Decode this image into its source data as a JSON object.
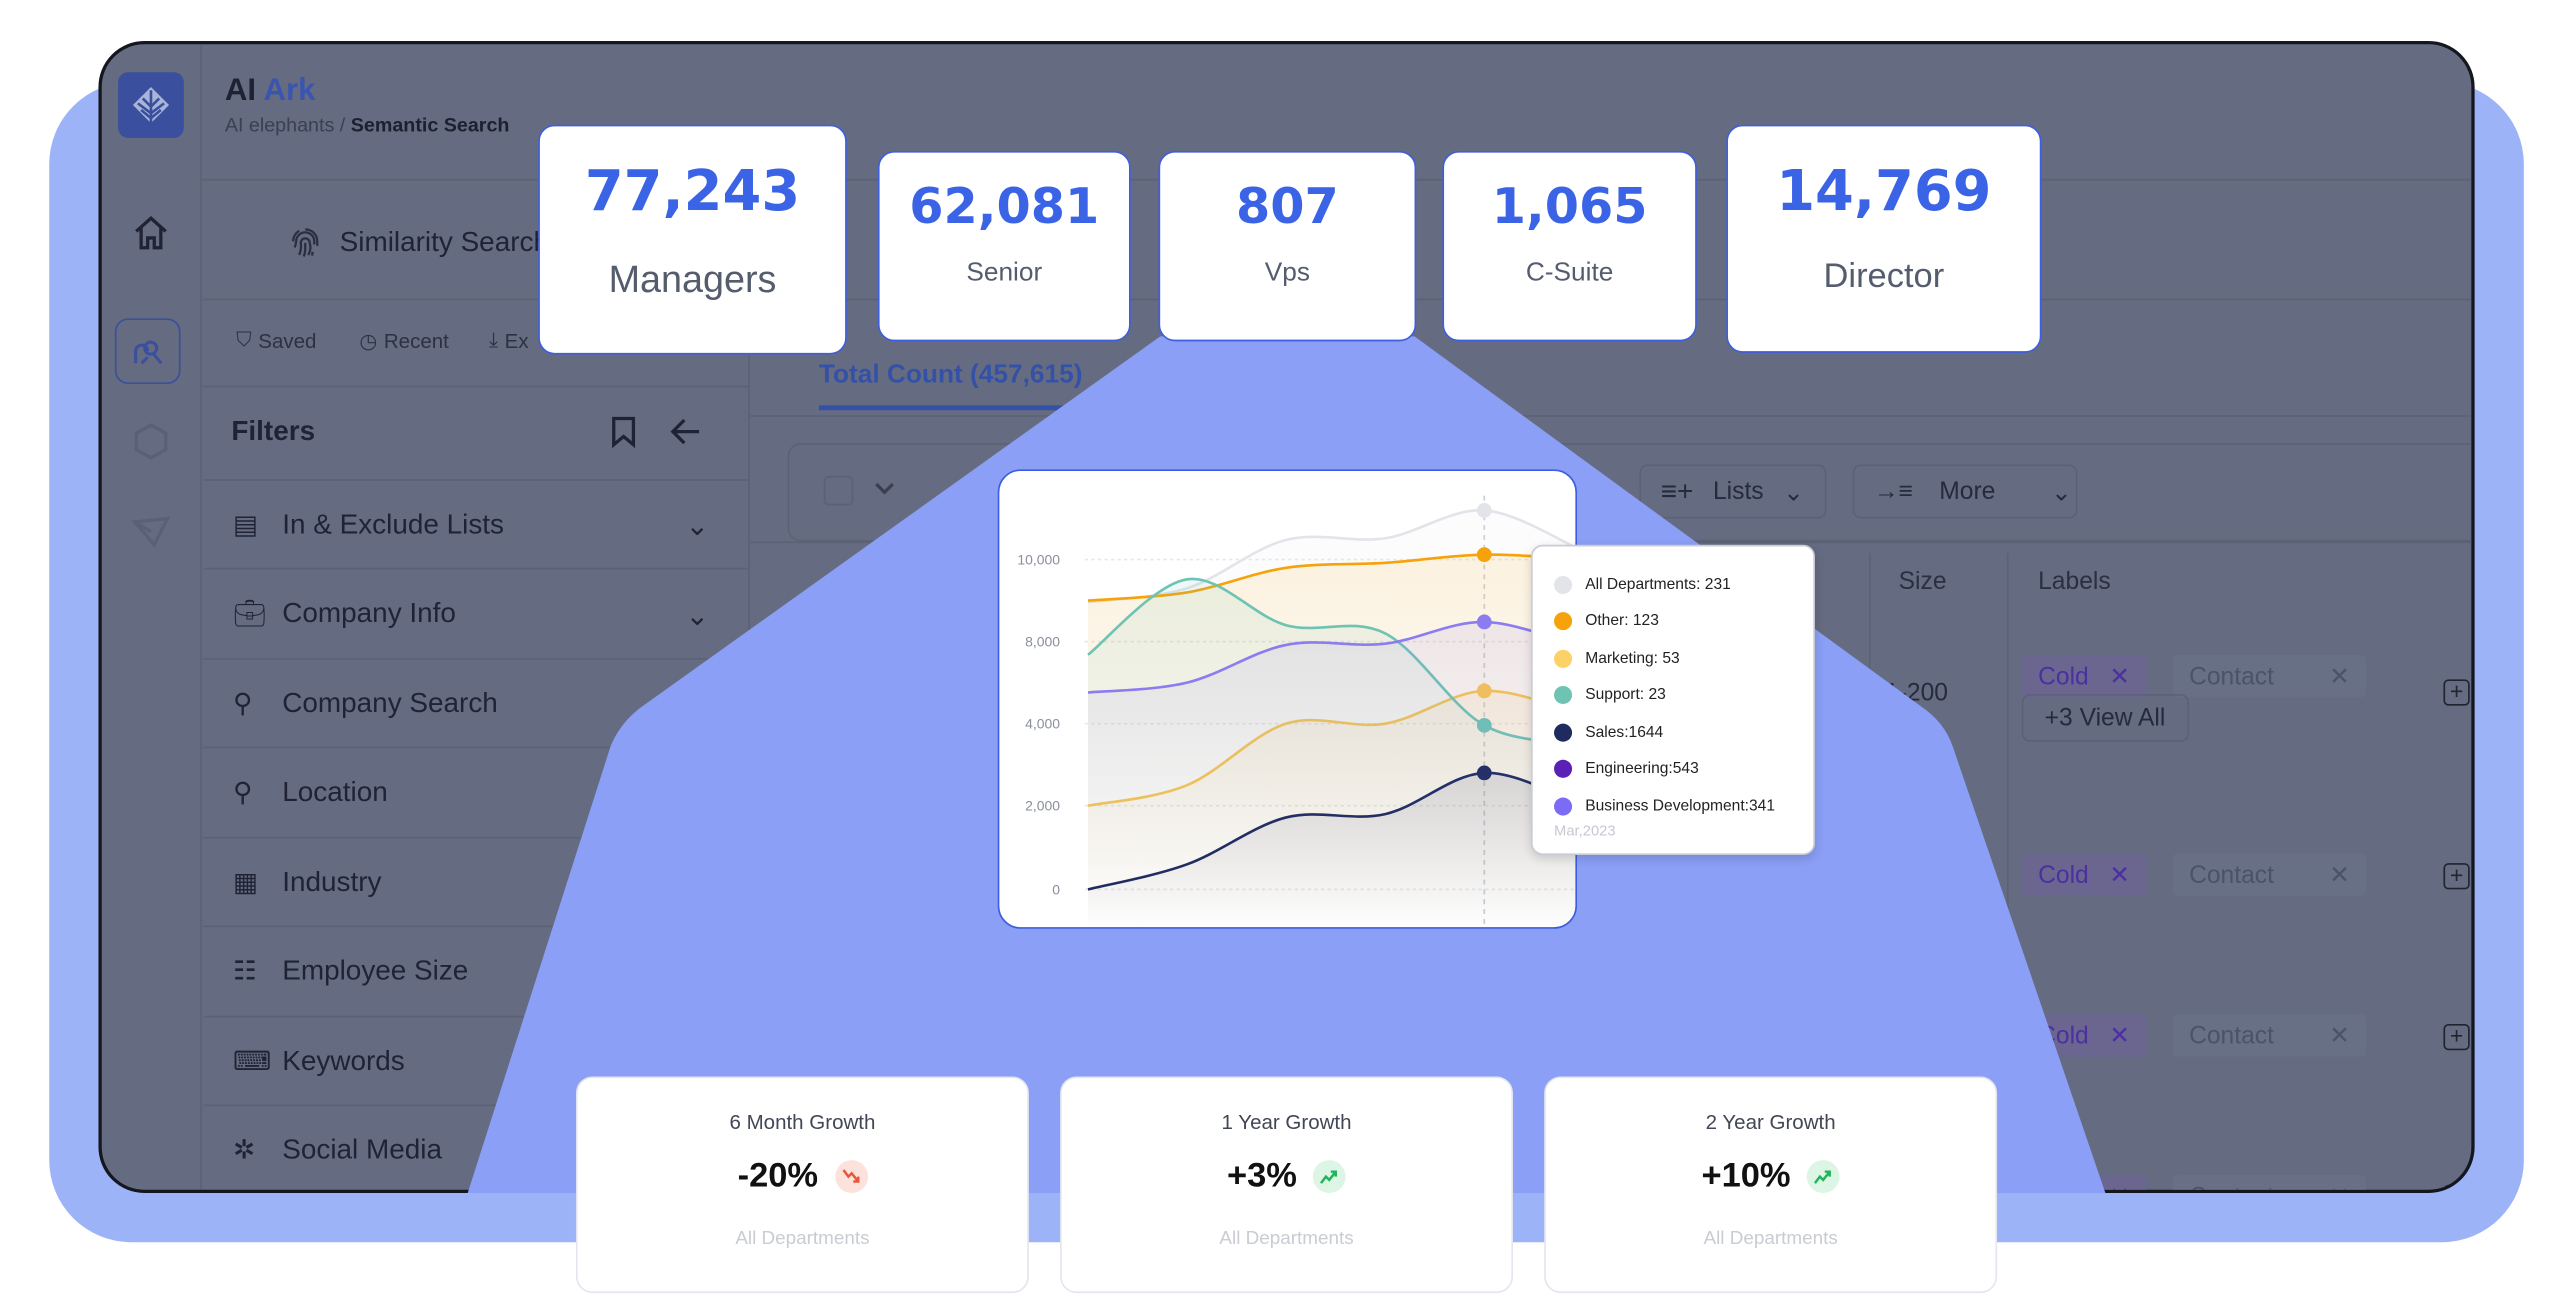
{
  "app": {
    "title_part1": "AI",
    "title_part2": "Ark",
    "breadcrumb_parent": "AI elephants /",
    "breadcrumb_current": "Semantic Search"
  },
  "panel": {
    "tab_label": "Similarity Search",
    "toolbar": {
      "saved": "Saved",
      "recent": "Recent",
      "export": "Ex"
    },
    "filters_title": "Filters",
    "filters": [
      {
        "label": "In & Exclude Lists",
        "icon": "list-icon",
        "expandable": true
      },
      {
        "label": "Company Info",
        "icon": "briefcase-icon",
        "expandable": true
      },
      {
        "label": "Company Search",
        "icon": "search-icon",
        "expandable": false
      },
      {
        "label": "Location",
        "icon": "location-pin-icon",
        "expandable": false
      },
      {
        "label": "Industry",
        "icon": "building-icon",
        "expandable": false
      },
      {
        "label": "Employee Size",
        "icon": "users-icon",
        "expandable": false
      },
      {
        "label": "Keywords",
        "icon": "keyboard-icon",
        "expandable": false
      },
      {
        "label": "Social Media",
        "icon": "network-icon",
        "expandable": false
      }
    ]
  },
  "main": {
    "tab_fragments": [
      "ch",
      "ch"
    ],
    "total_count": "Total Count (457,615)",
    "lists_button": "Lists",
    "more_button": "More",
    "columns": {
      "size": "Size",
      "labels": "Labels"
    },
    "rows": [
      {
        "size": "101-200",
        "labels": [
          "Cold",
          "Contact"
        ],
        "view_all": "+3 View All"
      },
      {
        "size": "",
        "labels": [
          "Cold",
          "Contact"
        ]
      },
      {
        "size": "",
        "labels": [
          "Cold",
          "Contact"
        ]
      },
      {
        "size": "",
        "labels": [
          "Cold",
          "Contact"
        ]
      }
    ]
  },
  "stats": [
    {
      "value": "77,243",
      "label": "Managers"
    },
    {
      "value": "62,081",
      "label": "Senior"
    },
    {
      "value": "807",
      "label": "Vps"
    },
    {
      "value": "1,065",
      "label": "C-Suite"
    },
    {
      "value": "14,769",
      "label": "Director"
    }
  ],
  "growth": [
    {
      "title": "6 Month Growth",
      "value": "-20%",
      "trend": "down",
      "subtitle": "All Departments"
    },
    {
      "title": "1 Year Growth",
      "value": "+3%",
      "trend": "up",
      "subtitle": "All Departments"
    },
    {
      "title": "2 Year Growth",
      "value": "+10%",
      "trend": "up",
      "subtitle": "All Departments"
    }
  ],
  "colors": {
    "accent": "#3a63e6",
    "highlight_bg": "#8a9ff5",
    "outer_bg": "#9db3f8",
    "down": "#e8553b",
    "up": "#22b45a"
  },
  "chart_data": {
    "type": "line",
    "title": "",
    "xlabel": "",
    "ylabel": "",
    "y_ticks": [
      "10,000",
      "8,000",
      "4,000",
      "2,000",
      "0"
    ],
    "grid": true,
    "series": [
      {
        "name": "All Departments",
        "color": "#e2e4e9",
        "values": [
          8960,
          9300,
          10480,
          10520,
          11200,
          10200
        ]
      },
      {
        "name": "Other",
        "color": "#f5a20b",
        "values": [
          9000,
          9200,
          9800,
          9920,
          10120,
          10000
        ]
      },
      {
        "name": "Marketing",
        "color": "#f8c550",
        "values": [
          2000,
          2500,
          4000,
          4000,
          5600,
          4400
        ]
      },
      {
        "name": "Support",
        "color": "#6ec3b3",
        "values": [
          7360,
          9520,
          8400,
          8200,
          3960,
          3500
        ]
      },
      {
        "name": "Sales",
        "color": "#1e2b5e",
        "values": [
          0,
          600,
          1720,
          1800,
          2800,
          2000
        ]
      },
      {
        "name": "Business Development",
        "color": "#8b7cf0",
        "values": [
          5520,
          6000,
          7840,
          7900,
          8480,
          7700
        ]
      }
    ],
    "highlight_index": 4,
    "tooltip": {
      "items": [
        {
          "label": "All Departments: 231",
          "color": "#e2e4e9"
        },
        {
          "label": "Other: 123",
          "color": "#f5a20b"
        },
        {
          "label": "Marketing: 53",
          "color": "#fcd267"
        },
        {
          "label": "Support: 23",
          "color": "#6ec3b3"
        },
        {
          "label": "Sales:1644",
          "color": "#1e2b5e"
        },
        {
          "label": "Engineering:543",
          "color": "#5b21b6"
        },
        {
          "label": "Business Development:341",
          "color": "#7c6cf5"
        }
      ],
      "date": "Mar,2023"
    }
  }
}
